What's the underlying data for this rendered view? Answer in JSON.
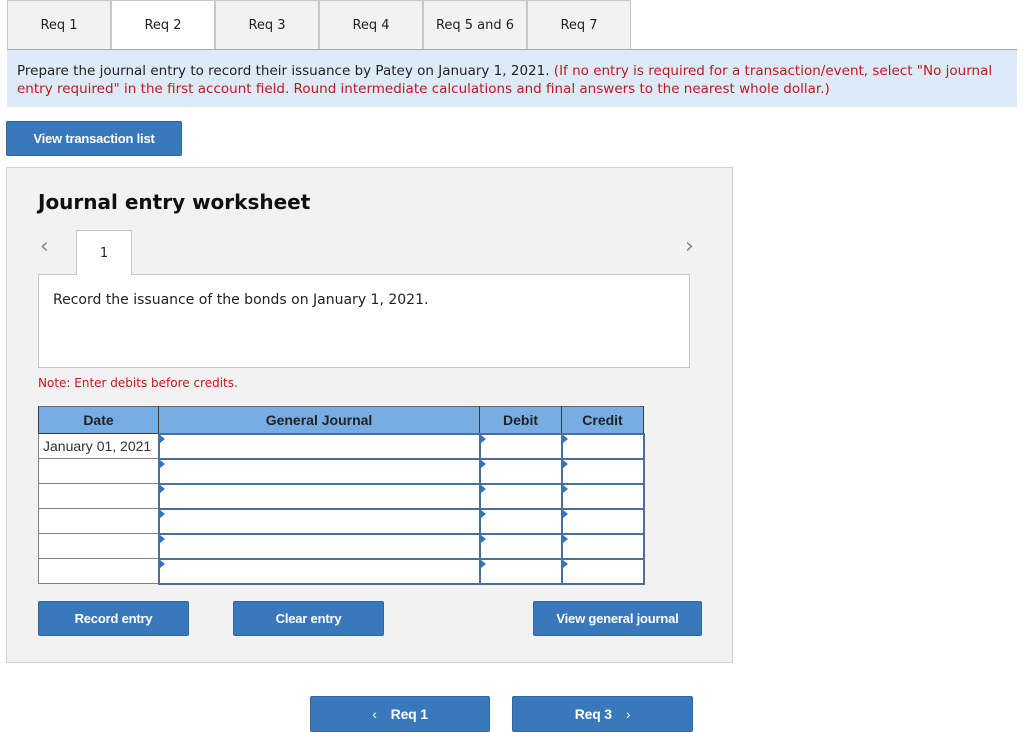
{
  "tabs": [
    {
      "label": "Req 1",
      "active": false
    },
    {
      "label": "Req 2",
      "active": true
    },
    {
      "label": "Req 3",
      "active": false
    },
    {
      "label": "Req 4",
      "active": false
    },
    {
      "label": "Req 5 and 6",
      "active": false
    },
    {
      "label": "Req 7",
      "active": false
    }
  ],
  "instructions": {
    "main": "Prepare the journal entry to record their issuance by Patey on January 1, 2021.",
    "note": "(If no entry is required for a transaction/event, select \"No journal entry required\" in the first account field. Round intermediate calculations and final answers to the nearest whole dollar.)"
  },
  "view_transaction_list_label": "View transaction list",
  "worksheet": {
    "title": "Journal entry worksheet",
    "prev_icon": "chevron-left-icon",
    "next_icon": "chevron-right-icon",
    "entry_tab_label": "1",
    "description": "Record the issuance of the bonds on January 1, 2021.",
    "note": "Note: Enter debits before credits.",
    "columns": [
      "Date",
      "General Journal",
      "Debit",
      "Credit"
    ],
    "rows": [
      {
        "date": "January 01, 2021",
        "account": "",
        "debit": "",
        "credit": ""
      },
      {
        "date": "",
        "account": "",
        "debit": "",
        "credit": ""
      },
      {
        "date": "",
        "account": "",
        "debit": "",
        "credit": ""
      },
      {
        "date": "",
        "account": "",
        "debit": "",
        "credit": ""
      },
      {
        "date": "",
        "account": "",
        "debit": "",
        "credit": ""
      },
      {
        "date": "",
        "account": "",
        "debit": "",
        "credit": ""
      }
    ],
    "buttons": {
      "record": "Record entry",
      "clear": "Clear entry",
      "view_journal": "View general journal"
    }
  },
  "bottom_nav": {
    "prev_label": "Req 1",
    "next_label": "Req 3"
  },
  "colors": {
    "accent": "#3a78bc",
    "header_blue": "#78ade3",
    "instruction_bg": "#ddebf8",
    "warning_red": "#c0181d"
  }
}
